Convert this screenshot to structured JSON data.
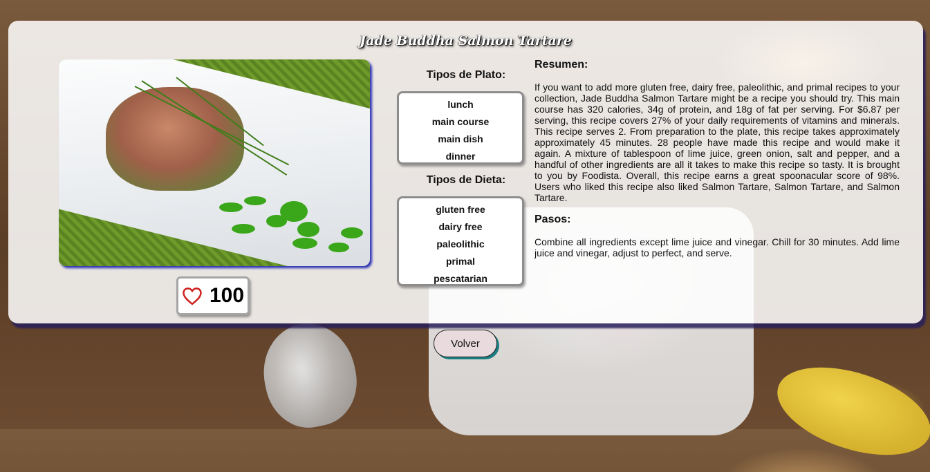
{
  "recipe": {
    "title": "Jade Buddha Salmon Tartare",
    "likes": "100",
    "dish_types_label": "Tipos de Plato:",
    "dish_types": [
      "lunch",
      "main course",
      "main dish",
      "dinner"
    ],
    "diet_types_label": "Tipos de Dieta:",
    "diet_types": [
      "gluten free",
      "dairy free",
      "paleolithic",
      "primal",
      "pescatarian"
    ],
    "summary_heading": "Resumen:",
    "summary": "If you want to add more gluten free, dairy free, paleolithic, and primal recipes to your collection, Jade Buddha Salmon Tartare might be a recipe you should try. This main course has 320 calories, 34g of protein, and 18g of fat per serving. For $6.87 per serving, this recipe covers 27% of your daily requirements of vitamins and minerals. This recipe serves 2. From preparation to the plate, this recipe takes approximately approximately 45 minutes. 28 people have made this recipe and would make it again. A mixture of tablespoon of lime juice, green onion, salt and pepper, and a handful of other ingredients are all it takes to make this recipe so tasty. It is brought to you by Foodista. Overall, this recipe earns a great spoonacular score of 98%. Users who liked this recipe also liked Salmon Tartare, Salmon Tartare, and Salmon Tartare.",
    "steps_heading": "Pasos:",
    "steps": "Combine all ingredients except lime juice and vinegar. Chill for 30 minutes. Add lime juice and vinegar, adjust to perfect, and serve."
  },
  "actions": {
    "back_label": "Volver"
  },
  "icons": {
    "like": "heart-outline-icon"
  },
  "colors": {
    "heart": "#d01f1f",
    "button_shadow": "#1a7d80",
    "card_shadow": "#28205a"
  }
}
